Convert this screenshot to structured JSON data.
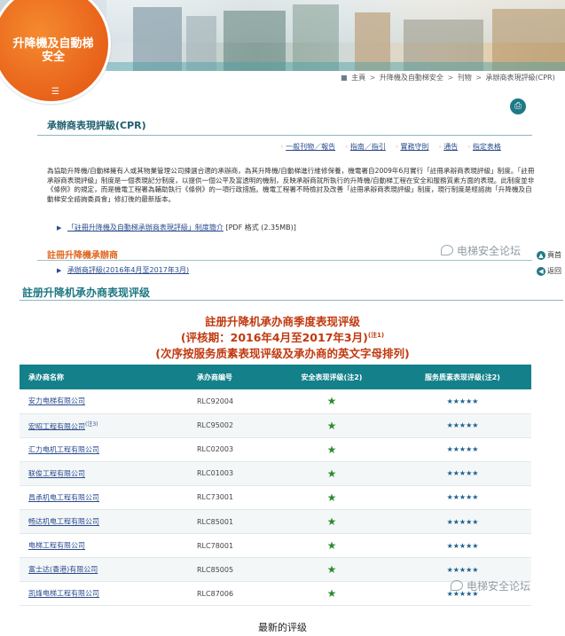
{
  "site": {
    "logo_title": "升降機及自動梯安全",
    "menu_icon": "menu-icon"
  },
  "breadcrumb": {
    "items": [
      "主頁",
      "升降機及自動梯安全",
      "刊物",
      "承辦商表現評級(CPR)"
    ]
  },
  "header": {
    "title": "承辦商表現評級(CPR)"
  },
  "links": {
    "items": [
      "一般刊物／報告",
      "指南／指引",
      "實務守則",
      "通告",
      "指定表格"
    ]
  },
  "intro": {
    "paragraph": "為協助升降機/自動梯擁有人或其物業管理公司揀選合適的承辦商，為其升降機/自動梯進行維修保養，機電署自2009年6月實行「註冊承辦商表現評級」制度。「註冊承辦商表現評級」制度是一個表現記分制度，以提供一個公平及富透明的機制，反映承辦商就所執行的升降機/自動梯工程在安全和服務質素方面的表現。此制度並非《條例》的規定，而是機電工程署為輔助執行《條例》的一項行政措施。機電工程署不時檢討及改善「註冊承辦商表現評級」制度，現行制度是經諮詢「升降機及自動梯安全諮詢委員會」修訂後的最新版本。",
    "download_link": "「註冊升降機及自動梯承辦商表現評級」制度簡介",
    "download_meta": "[PDF 格式 (2.35MB)]"
  },
  "section_lift": {
    "title": "註冊升降機承辦商",
    "link": "承辦商評級(2016年4月至2017年3月)"
  },
  "side_nav": {
    "top_label": "頁首",
    "back_label": "返回"
  },
  "watermark": {
    "text": "电梯安全论坛"
  },
  "report": {
    "section_title": "註册升降机承办商表现评级",
    "heading1": "註册升降机承办商季度表现评级",
    "heading2": "(评核期：2016年4月至2017年3月)",
    "heading2_note": "(注1)",
    "heading3": "(次序按服务质素表现评级及承办商的英文字母排列)"
  },
  "table": {
    "headers": [
      "承办商名称",
      "承办商编号",
      "安全表现评级(注2)",
      "服务质素表现评级(注2)"
    ],
    "rows": [
      {
        "name": "安力电梯有限公司",
        "note": "",
        "code": "RLC92004",
        "safety": "★",
        "service": "★★★★★"
      },
      {
        "name": "宏昭工程有限公司",
        "note": "(注3)",
        "code": "RLC95002",
        "safety": "★",
        "service": "★★★★★"
      },
      {
        "name": "汇力电机工程有限公司",
        "note": "",
        "code": "RLC02003",
        "safety": "★",
        "service": "★★★★★"
      },
      {
        "name": "联俊工程有限公司",
        "note": "",
        "code": "RLC01003",
        "safety": "★",
        "service": "★★★★★"
      },
      {
        "name": "昌承机电工程有限公司",
        "note": "",
        "code": "RLC73001",
        "safety": "★",
        "service": "★★★★★"
      },
      {
        "name": "畅达机电工程有限公司",
        "note": "",
        "code": "RLC85001",
        "safety": "★",
        "service": "★★★★★"
      },
      {
        "name": "电梯工程有限公司",
        "note": "",
        "code": "RLC78001",
        "safety": "★",
        "service": "★★★★★"
      },
      {
        "name": "富士达(香港)有限公司",
        "note": "",
        "code": "RLC85005",
        "safety": "★",
        "service": "★★★★★"
      },
      {
        "name": "凯烽电梯工程有限公司",
        "note": "",
        "code": "RLC87006",
        "safety": "★",
        "service": "★★★★★"
      }
    ]
  },
  "caption": {
    "text": "最新的评级"
  },
  "colors": {
    "brand_orange": "#e8621a",
    "teal": "#13808a",
    "report_red": "#c0390f",
    "star_green": "#2e8b2e",
    "star_blue": "#1a5f8f"
  }
}
